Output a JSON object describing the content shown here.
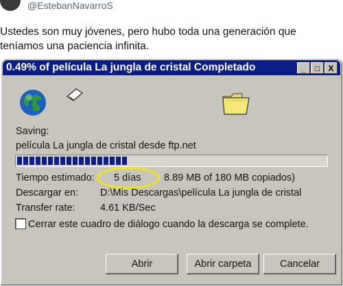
{
  "tweet": {
    "handle": "@EstebanNavarroS",
    "text": "Ustedes son muy jóvenes, pero hubo toda una generación que teníamos una paciencia infinita."
  },
  "dialog": {
    "title": "0.49% of película La jungla de cristal Completado",
    "window_buttons": {
      "minimize": "_",
      "maximize": "□",
      "close": "X"
    },
    "icons": [
      "globe-icon",
      "paper-icon",
      "folder-icon"
    ],
    "saving_label": "Saving:",
    "saving_file": "película La jungla de cristal desde ftp.net",
    "progress_fraction": 0.0049,
    "progress_segments_shown": 18,
    "estimated_time_label": "Tiempo estimado:",
    "estimated_time_value": "5 días",
    "copied_value": "8.89 MB of 180 MB copiados)",
    "download_to_label": "Descargar en:",
    "download_to_value": "D:\\Mis Descargas\\película La jungla de cristal",
    "transfer_rate_label": "Transfer rate:",
    "transfer_rate_value": "4.61 KB/Sec",
    "close_on_complete_label": "Cerrar este cuadro de diálogo cuando la descarga se complete.",
    "close_on_complete_checked": false,
    "buttons": {
      "open": "Abrir",
      "open_folder": "Abrir carpeta",
      "cancel": "Cancelar"
    },
    "colors": {
      "titlebar": "#0b1e85",
      "face": "#c8c5bd",
      "progress": "#0b1e85",
      "highlight_ellipse": "#f2e419"
    }
  }
}
